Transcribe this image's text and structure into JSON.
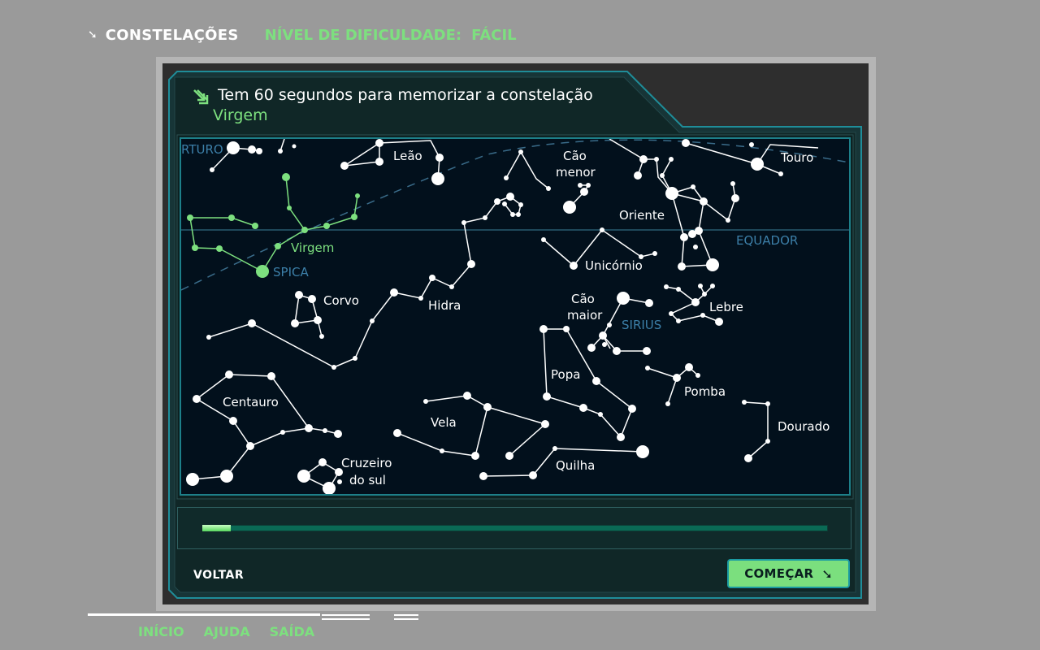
{
  "header": {
    "title": "CONSTELAÇÕES",
    "level_label": "NÍVEL DE DIFICULDADE:",
    "level_value": "FÁCIL",
    "arrow_icon": "arrow-down-right-icon"
  },
  "message": {
    "line1": "Tem 60 segundos para memorizar a constelação",
    "constellation": "Virgem",
    "icon": "double-arrow-down-right-icon"
  },
  "map": {
    "equator_label": "EQUADOR",
    "constellations": [
      {
        "name": "Leão"
      },
      {
        "name": "Cão menor",
        "lines": [
          "Cão",
          "menor"
        ]
      },
      {
        "name": "Touro"
      },
      {
        "name": "Oriente"
      },
      {
        "name": "Virgem",
        "highlight": true
      },
      {
        "name": "Unicórnio"
      },
      {
        "name": "Corvo"
      },
      {
        "name": "Hidra"
      },
      {
        "name": "Cão maior",
        "lines": [
          "Cão",
          "maior"
        ]
      },
      {
        "name": "Lebre"
      },
      {
        "name": "Popa"
      },
      {
        "name": "Pomba"
      },
      {
        "name": "Centauro"
      },
      {
        "name": "Vela"
      },
      {
        "name": "Dourado"
      },
      {
        "name": "Cruzeiro do sul",
        "lines": [
          "Cruzeiro",
          "do sul"
        ]
      },
      {
        "name": "Quilha"
      }
    ],
    "stars": [
      "RTURO",
      "SPICA",
      "SIRIUS"
    ]
  },
  "progress": {
    "fraction": 0.045
  },
  "buttons": {
    "back": "VOLTAR",
    "start": "COMEÇAR",
    "start_icon": "arrow-down-right-icon"
  },
  "colors": {
    "accent_green": "#7de07f",
    "star_label_blue": "#3c7fa8",
    "panel_border": "#1f8d99"
  },
  "footer_nav": [
    "INÍCIO",
    "AJUDA",
    "SAÍDA"
  ]
}
